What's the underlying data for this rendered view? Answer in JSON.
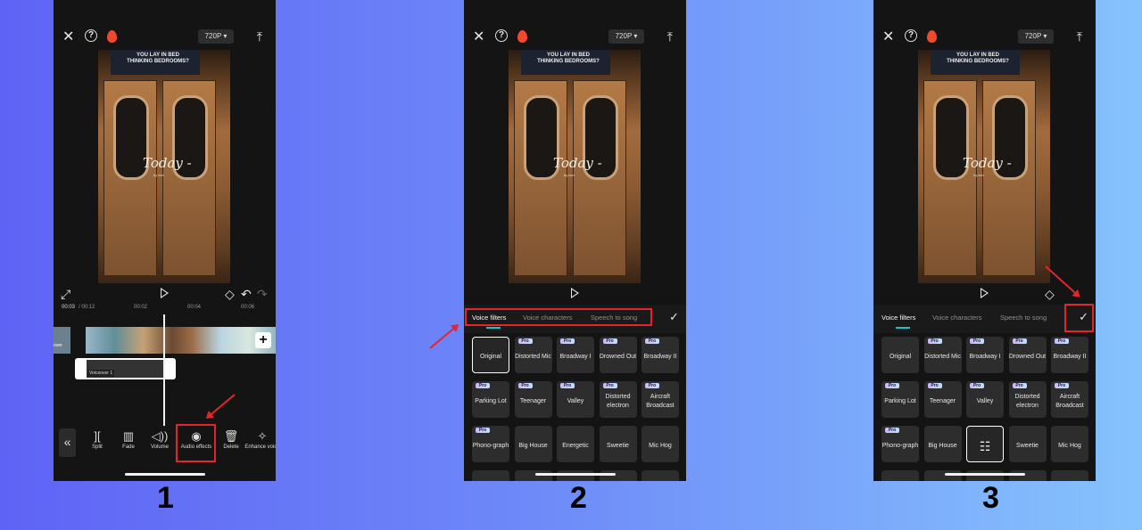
{
  "editor": {
    "resolution": "720P ▾",
    "icons": {
      "close": "✕",
      "help": "?",
      "upload": "⤒",
      "fullscreen": "⤢",
      "keyframe": "◇",
      "undo": "↶",
      "redo": "↷"
    },
    "video_overlay": {
      "ad_text": "YOU LAY IN BED THINKING BEDROOMS?",
      "title": "Today -",
      "subtitle": "by text"
    }
  },
  "timeline": {
    "current": "00:03",
    "total": "/ 00:12",
    "ticks": [
      "00:02",
      "00:04",
      "00:06"
    ],
    "cover_label": "over",
    "voiceover_label": "Voiceover 1",
    "add_icon": "+"
  },
  "toolbar": {
    "back_icon": "«",
    "tools": [
      {
        "label": "Split",
        "icon": "]["
      },
      {
        "label": "Fade",
        "icon": "▥"
      },
      {
        "label": "Volume",
        "icon": "◁))"
      },
      {
        "label": "Audio effects",
        "icon": "◉"
      },
      {
        "label": "Delete",
        "icon": "🗑"
      },
      {
        "label": "Enhance voice",
        "icon": "✧"
      }
    ]
  },
  "audio_panel": {
    "tabs": [
      "Voice filters",
      "Voice characters",
      "Speech to song"
    ],
    "active_tab": "Voice filters",
    "confirm_icon": "✓",
    "pro_badge": "Pro",
    "filters": [
      {
        "label": "Original",
        "pro": false
      },
      {
        "label": "Distorted Mic",
        "pro": true
      },
      {
        "label": "Broadway I",
        "pro": true
      },
      {
        "label": "Drowned Out",
        "pro": true
      },
      {
        "label": "Broadway II",
        "pro": true
      },
      {
        "label": "Parking Lot",
        "pro": true
      },
      {
        "label": "Teenager",
        "pro": true
      },
      {
        "label": "Valley",
        "pro": true
      },
      {
        "label": "Distorted electron",
        "pro": true
      },
      {
        "label": "Aircraft Broadcast",
        "pro": true
      },
      {
        "label": "Phono-graph",
        "pro": true
      },
      {
        "label": "Big House",
        "pro": false
      },
      {
        "label": "Energetic",
        "pro": false
      },
      {
        "label": "Sweetie",
        "pro": false
      },
      {
        "label": "Mic Hog",
        "pro": false
      }
    ],
    "adjust_icon": "☷"
  },
  "steps": [
    "1",
    "2",
    "3"
  ]
}
